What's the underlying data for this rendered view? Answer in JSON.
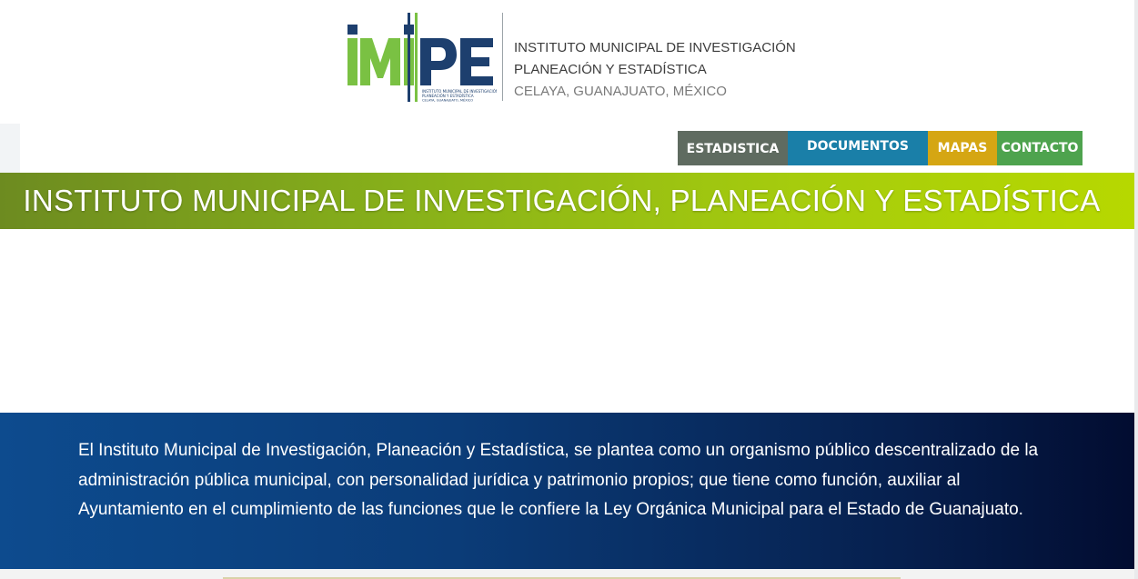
{
  "header": {
    "logo_text": "iMiPE",
    "logo_small_text": "INSTITUTO MUNICIPAL DE INVESTIGACIÓN PLANEACIÓN Y ESTADÍSTICA CELAYA, GUANAJUATO, MÉXICO",
    "title_line1": "INSTITUTO MUNICIPAL DE INVESTIGACIÓN",
    "title_line2": "PLANEACIÓN Y ESTADÍSTICA",
    "location": "CELAYA, GUANAJUATO, MÉXICO"
  },
  "nav": {
    "items": [
      {
        "label": "ESTADISTICA",
        "color": "#5f6b60"
      },
      {
        "label": "DOCUMENTOS",
        "color": "#1a7fa8"
      },
      {
        "label": "MAPAS",
        "color": "#d5a613"
      },
      {
        "label": "CONTACTO",
        "color": "#4ea34e"
      }
    ]
  },
  "banner": {
    "title": "INSTITUTO MUNICIPAL DE INVESTIGACIÓN, PLANEACIÓN Y ESTADÍSTICA"
  },
  "info": {
    "text": "El Instituto Municipal de Investigación, Planeación y Estadística, se plantea como un organismo público descentralizado de la administración pública municipal, con personalidad jurídica y patrimonio propios; que tiene como función, auxiliar al Ayuntamiento en el cumplimiento de las funciones que le confiere la Ley Orgánica Municipal para el Estado de Guanajuato."
  },
  "colors": {
    "logo_green": "#7ac143",
    "logo_navy": "#1d3f6e",
    "banner_start": "#6d8b20",
    "banner_end": "#b7d800",
    "info_start": "#0d4b8e",
    "info_end": "#020c30"
  }
}
